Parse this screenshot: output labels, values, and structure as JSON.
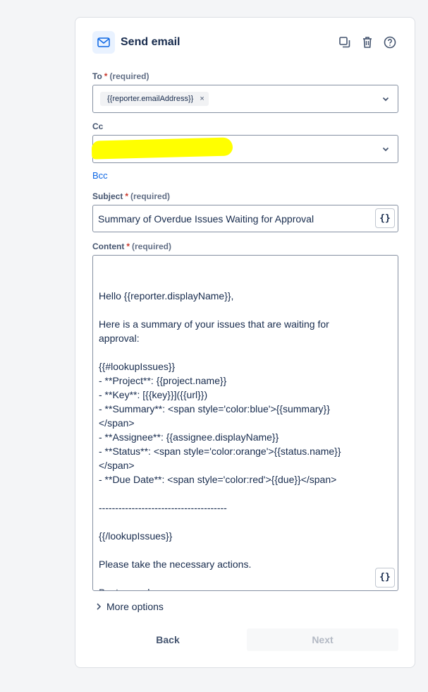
{
  "header": {
    "title": "Send email",
    "icons": [
      "mail-icon",
      "duplicate-icon",
      "trash-icon",
      "help-icon"
    ]
  },
  "to": {
    "label": "To",
    "required_star": "*",
    "required_text": "(required)",
    "chip": "{{reporter.emailAddress}}",
    "chip_remove": "×"
  },
  "cc": {
    "label": "Cc"
  },
  "bcc_label": "Bcc",
  "subject": {
    "label": "Subject",
    "required_star": "*",
    "required_text": "(required)",
    "value": "Summary of Overdue Issues Waiting for Approval",
    "smart_value_button": "{}"
  },
  "content": {
    "label": "Content",
    "required_star": "*",
    "required_text": "(required)",
    "value": "Hello {{reporter.displayName}},\n\nHere is a summary of your issues that are waiting for\napproval:\n\n{{#lookupIssues}}\n- **Project**: {{project.name}}\n- **Key**: [{{key}}]({{url}})\n- **Summary**: <span style='color:blue'>{{summary}}\n</span>\n- **Assignee**: {{assignee.displayName}}\n- **Status**: <span style='color:orange'>{{status.name}}\n</span>\n- **Due Date**: <span style='color:red'>{{due}}</span>\n\n---------------------------------------\n\n{{/lookupIssues}}\n\nPlease take the necessary actions.\n\nBest regards,\nYour Jira Automation System",
    "smart_value_button": "{}"
  },
  "more_options": "More options",
  "footer": {
    "back": "Back",
    "next": "Next"
  },
  "colors": {
    "accent": "#0c66e4",
    "required": "#c9372c",
    "redaction": "#ffff00"
  }
}
